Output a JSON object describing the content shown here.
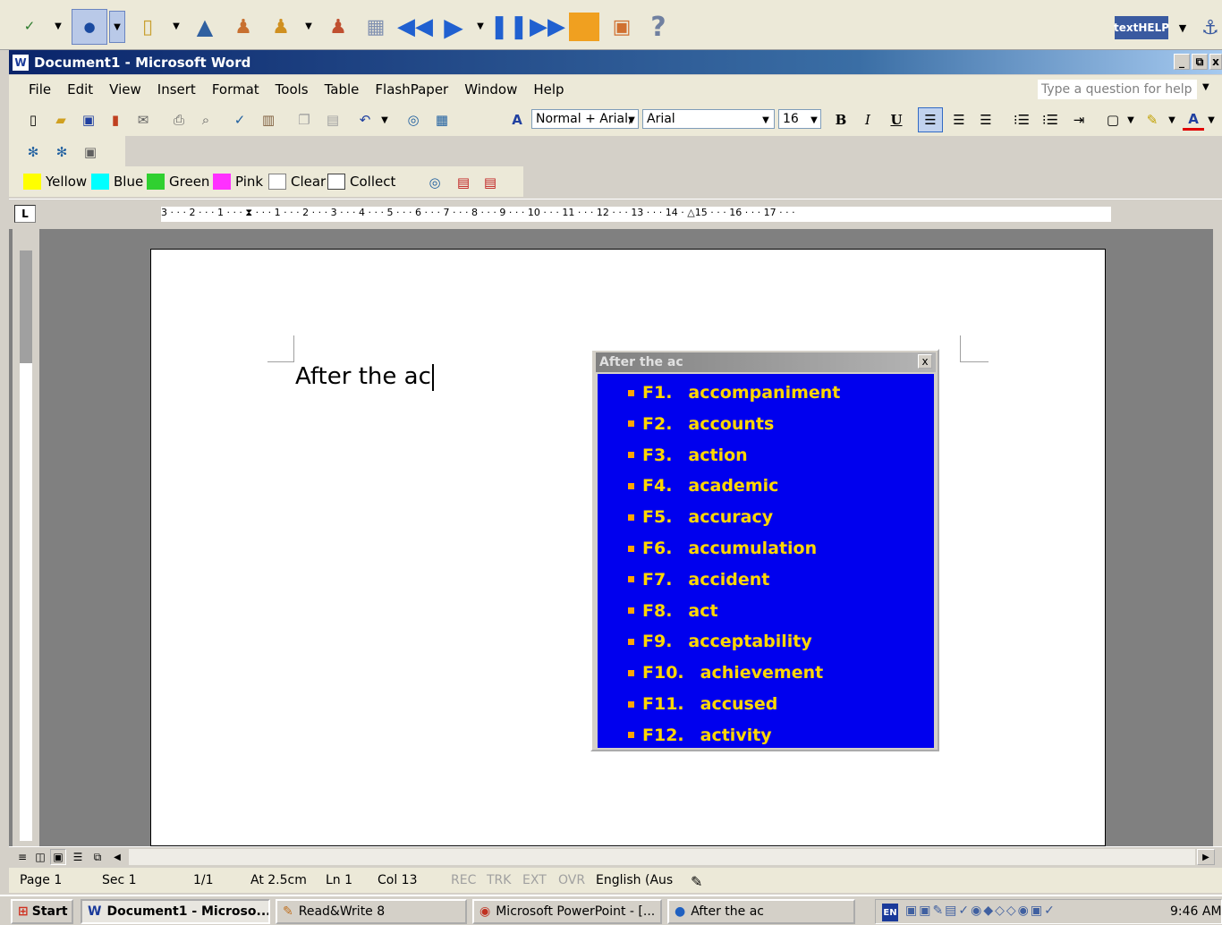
{
  "rw_toolbar": {
    "brand": "textHELP",
    "help_icon": "?"
  },
  "window": {
    "title": "Document1 - Microsoft Word",
    "controls": [
      "_",
      "⧉",
      "x"
    ]
  },
  "menu": {
    "items": [
      "File",
      "Edit",
      "View",
      "Insert",
      "Format",
      "Tools",
      "Table",
      "FlashPaper",
      "Window",
      "Help"
    ],
    "help_placeholder": "Type a question for help"
  },
  "formatting": {
    "style": "Normal + Arial,",
    "font": "Arial",
    "size": "16",
    "bold": "B",
    "italic": "I",
    "underline": "U"
  },
  "highlight_toolbar": {
    "yellow": "Yellow",
    "blue": "Blue",
    "green": "Green",
    "pink": "Pink",
    "clear": "Clear",
    "collect": "Collect"
  },
  "ruler": {
    "ticks": "3 · · · 2 · · · 1 · · · ⧗ · · · 1 · · · 2 · · · 3 · · · 4 · · · 5 · · · 6 · · · 7 · · · 8 · · · 9 · · · 10 · · · 11 · · · 12 · · · 13 · · · 14 · △15 · · · 16 · · · 17 · · ·",
    "tab_marker": "L"
  },
  "document": {
    "text": "After the ac"
  },
  "prediction": {
    "title": "After the ac",
    "close": "x",
    "suggestions": [
      {
        "key": "F1.",
        "word": "accompaniment"
      },
      {
        "key": "F2.",
        "word": "accounts"
      },
      {
        "key": "F3.",
        "word": "action"
      },
      {
        "key": "F4.",
        "word": "academic"
      },
      {
        "key": "F5.",
        "word": "accuracy"
      },
      {
        "key": "F6.",
        "word": "accumulation"
      },
      {
        "key": "F7.",
        "word": "accident"
      },
      {
        "key": "F8.",
        "word": "act"
      },
      {
        "key": "F9.",
        "word": "acceptability"
      },
      {
        "key": "F10.",
        "word": "achievement"
      },
      {
        "key": "F11.",
        "word": "accused"
      },
      {
        "key": "F12.",
        "word": "activity"
      }
    ]
  },
  "status": {
    "page": "Page 1",
    "sec": "Sec 1",
    "pages": "1/1",
    "at": "At 2.5cm",
    "ln": "Ln 1",
    "col": "Col 13",
    "rec": "REC",
    "trk": "TRK",
    "ext": "EXT",
    "ovr": "OVR",
    "lang": "English (Aus"
  },
  "taskbar": {
    "start": "Start",
    "tasks": [
      "Document1 - Microso...",
      "Read&Write 8",
      "Microsoft PowerPoint - [...",
      "After the ac"
    ],
    "lang": "EN",
    "time": "9:46 AM"
  }
}
